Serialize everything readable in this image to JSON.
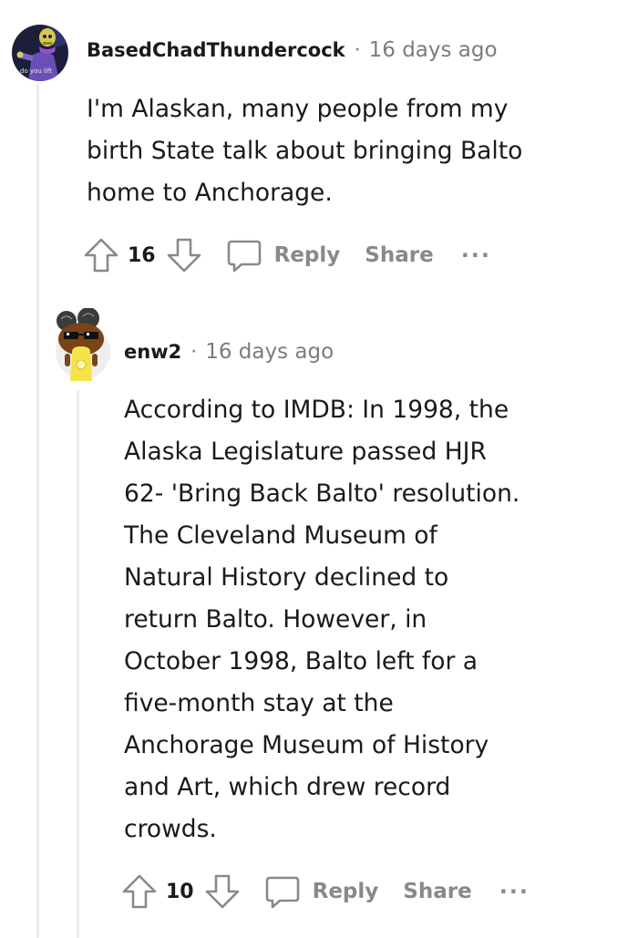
{
  "comments": [
    {
      "username": "BasedChadThundercock",
      "separator": "·",
      "timestamp": "16 days ago",
      "avatar_caption": "do you lift",
      "body_lines": [
        "I'm Alaskan, many people from my",
        "birth State talk about bringing Balto",
        "home to Anchorage."
      ],
      "score": "16",
      "reply_label": "Reply",
      "share_label": "Share",
      "more_label": "···"
    },
    {
      "username": "enw2",
      "separator": "·",
      "timestamp": "16 days ago",
      "body_lines": [
        "According to IMDB: In 1998, the",
        "Alaska Legislature passed HJR",
        "62- 'Bring Back Balto' resolution.",
        "The Cleveland Museum of",
        "Natural History declined to",
        "return Balto. However, in",
        "October 1998, Balto left for a",
        "five-month stay at the",
        "Anchorage Museum of History",
        "and Art, which drew record",
        "crowds."
      ],
      "score": "10",
      "reply_label": "Reply",
      "share_label": "Share",
      "more_label": "···"
    }
  ],
  "colors": {
    "text": "#1a1a1b",
    "meta": "#7c7c7c",
    "action": "#878a8c",
    "thread_line": "#e9ebed"
  },
  "icons": [
    "upvote-arrow-icon",
    "downvote-arrow-icon",
    "comment-bubble-icon"
  ]
}
